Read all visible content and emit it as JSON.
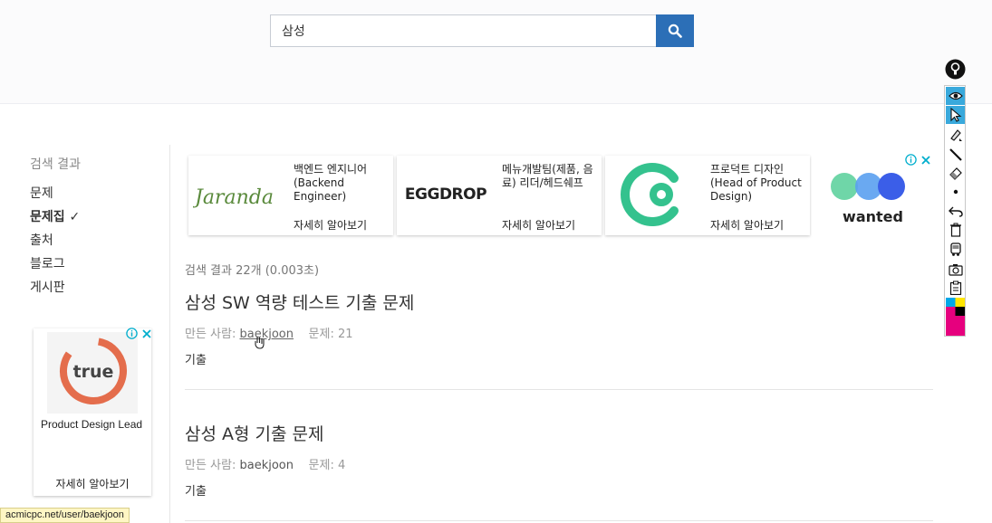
{
  "search": {
    "value": "삼성"
  },
  "sidebar": {
    "title": "검색 결과",
    "items": [
      {
        "label": "문제"
      },
      {
        "label": "문제집 ✓"
      },
      {
        "label": "출처"
      },
      {
        "label": "블로그"
      },
      {
        "label": "게시판"
      }
    ]
  },
  "side_ad": {
    "logo_text": "true",
    "title": "Product Design Lead",
    "cta": "자세히 알아보기"
  },
  "ads": [
    {
      "logo_text": "Jaranda",
      "title": "백엔드 엔지니어 (Backend Engineer)",
      "cta": "자세히 알아보기"
    },
    {
      "logo_text": "EGGDROP",
      "title": "메뉴개발팀(제품, 음료) 리더/헤드쉐프",
      "cta": "자세히 알아보기"
    },
    {
      "logo_text": "",
      "title": "프로덕트 디자인 (Head of Product Design)",
      "cta": "자세히 알아보기"
    },
    {
      "logo_text": "wanted"
    }
  ],
  "results": {
    "count_text": "검색 결과 22개 (0.003초)",
    "items": [
      {
        "title": "삼성 SW 역량 테스트 기출 문제",
        "author_label": "만든 사람:",
        "author": "baekjoon",
        "problems": "문제: 21",
        "tag": "기출"
      },
      {
        "title": "삼성 A형 기출 문제",
        "author_label": "만든 사람:",
        "author": "baekjoon",
        "problems": "문제: 4",
        "tag": "기출"
      }
    ]
  },
  "status_bar": {
    "url": "acmicpc.net/user/baekjoon"
  },
  "colors": {
    "accent": "#2c6fb7",
    "tool_active": "#39a9dc",
    "wanted_green": "#6fd6a8",
    "wanted_blue": "#3b5ee8"
  },
  "icons": [
    "search-icon",
    "info-icon",
    "close-icon",
    "lightbulb-icon",
    "eye-icon",
    "pointer-icon",
    "highlighter-icon",
    "pen-icon",
    "eraser-icon",
    "dot-icon",
    "undo-icon",
    "trash-icon",
    "bus-icon",
    "camera-icon",
    "clipboard-icon",
    "hand-cursor-icon"
  ]
}
